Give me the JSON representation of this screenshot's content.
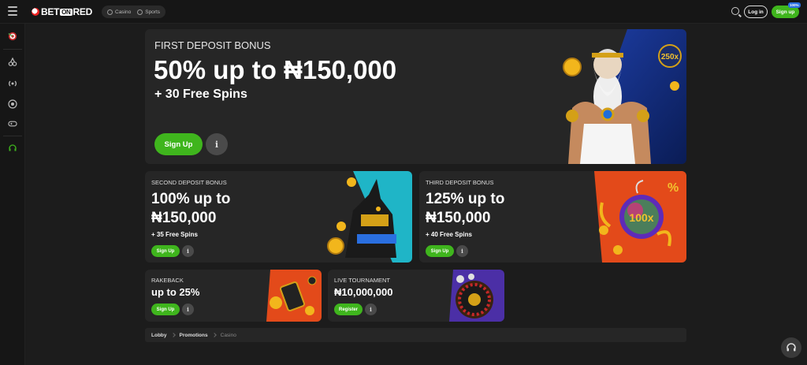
{
  "header": {
    "logo": {
      "bet": "BET",
      "on": "ON",
      "red": "RED"
    },
    "nav": [
      {
        "label": "Casino",
        "icon": "cherries-icon"
      },
      {
        "label": "Sports",
        "icon": "football-icon"
      }
    ],
    "login_label": "Log in",
    "signup_label": "Sign up",
    "badge": "100%"
  },
  "sidebar": {
    "icons": [
      "dartboard-icon",
      "cherries-icon",
      "live-icon",
      "football-icon",
      "gamepad-icon",
      "support-icon"
    ]
  },
  "hero": {
    "label": "FIRST DEPOSIT BONUS",
    "title": "50% up to ₦150,000",
    "subtitle": "+ 30 Free Spins",
    "button": "Sign Up",
    "info": "i",
    "badge": "250x"
  },
  "second": {
    "label": "SECOND DEPOSIT BONUS",
    "title_line1": "100% up to",
    "title_line2": "₦150,000",
    "subtitle": "+ 35 Free Spins",
    "button": "Sign Up",
    "info": "i"
  },
  "third": {
    "label": "THIRD DEPOSIT BONUS",
    "title_line1": "125% up to",
    "title_line2": "₦150,000",
    "subtitle": "+ 40 Free Spins",
    "button": "Sign Up",
    "info": "i",
    "badge": "100x"
  },
  "rakeback": {
    "label": "RAKEBACK",
    "title": "up to 25%",
    "button": "Sign Up",
    "info": "i"
  },
  "tournament": {
    "label": "LIVE TOURNAMENT",
    "title": "₦10,000,000",
    "button": "Register",
    "info": "i"
  },
  "breadcrumb": [
    "Lobby",
    "Promotions",
    "Casino"
  ],
  "colors": {
    "accent": "#3fb51d",
    "background": "#1c1c1c",
    "card": "#262626"
  }
}
